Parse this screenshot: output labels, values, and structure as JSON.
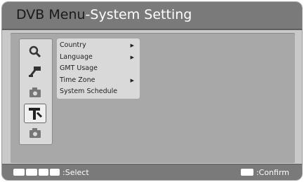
{
  "title": {
    "prefix": "DVB Menu",
    "separator": "-",
    "suffix": "System Setting"
  },
  "sidebar": {
    "icons": [
      {
        "name": "search-icon",
        "active": false
      },
      {
        "name": "hammer-icon",
        "active": false
      },
      {
        "name": "camera-icon",
        "active": false
      },
      {
        "name": "tools-icon",
        "active": true
      },
      {
        "name": "camera-icon-2",
        "active": false
      }
    ]
  },
  "menu": {
    "items": [
      {
        "label": "Country",
        "has_submenu": true
      },
      {
        "label": "Language",
        "has_submenu": true
      },
      {
        "label": "GMT Usage",
        "has_submenu": false
      },
      {
        "label": "Time Zone",
        "has_submenu": true
      },
      {
        "label": "System Schedule",
        "has_submenu": false
      }
    ],
    "arrow_symbol": "▶"
  },
  "footer": {
    "select_label": ":Select",
    "confirm_label": ":Confirm"
  },
  "colors": {
    "title_bar": "#7a7a7a",
    "panel": "#a8a8a8",
    "menu_bg": "#d9d9d9"
  }
}
